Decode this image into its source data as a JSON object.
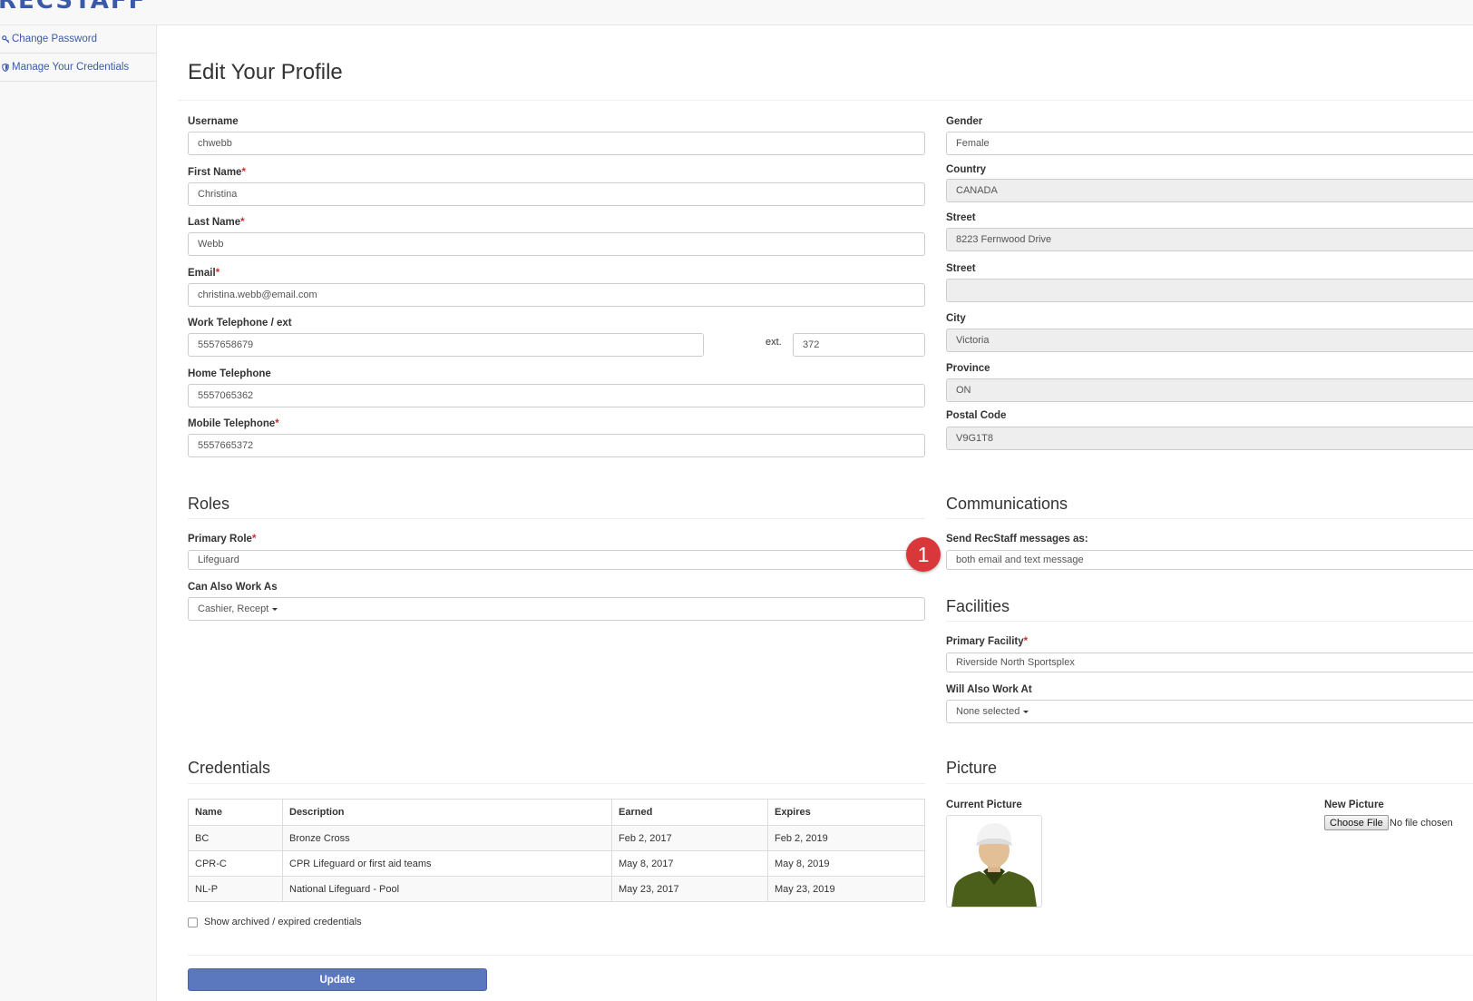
{
  "app": {
    "logo": "RECSTAFF"
  },
  "sidebar": {
    "items": [
      {
        "label": "Change Password",
        "icon": "key-icon"
      },
      {
        "label": "Manage Your Credentials",
        "icon": "shield-icon"
      }
    ]
  },
  "page": {
    "title": "Edit Your Profile"
  },
  "profile": {
    "username_label": "Username",
    "username": "chwebb",
    "first_name_label": "First Name",
    "first_name": "Christina",
    "last_name_label": "Last Name",
    "last_name": "Webb",
    "email_label": "Email",
    "email": "christina.webb@email.com",
    "work_phone_label": "Work Telephone / ext",
    "work_phone": "5557658679",
    "ext_label": "ext.",
    "ext": "372",
    "home_phone_label": "Home Telephone",
    "home_phone": "5557065362",
    "mobile_phone_label": "Mobile Telephone",
    "mobile_phone": "5557665372",
    "required_mark": "*"
  },
  "address": {
    "gender_label": "Gender",
    "gender": "Female",
    "country_label": "Country",
    "country": "CANADA",
    "street_label": "Street",
    "street1": "8223 Fernwood Drive",
    "street2_label": "Street",
    "street2": "",
    "city_label": "City",
    "city": "Victoria",
    "province_label": "Province",
    "province": "ON",
    "postal_label": "Postal Code",
    "postal": "V9G1T8"
  },
  "roles": {
    "heading": "Roles",
    "primary_label": "Primary Role",
    "primary": "Lifeguard",
    "also_label": "Can Also Work As",
    "also": "Cashier, Recept"
  },
  "communications": {
    "heading": "Communications",
    "send_label": "Send RecStaff messages as:",
    "send_value": "both email and text message",
    "badge": "1",
    "badge_color": "#d9383a"
  },
  "facilities": {
    "heading": "Facilities",
    "primary_label": "Primary Facility",
    "primary": "Riverside North Sportsplex",
    "also_label": "Will Also Work At",
    "also": "None selected"
  },
  "credentials": {
    "heading": "Credentials",
    "columns": [
      "Name",
      "Description",
      "Earned",
      "Expires"
    ],
    "rows": [
      [
        "BC",
        "Bronze Cross",
        "Feb 2, 2017",
        "Feb 2, 2019"
      ],
      [
        "CPR-C",
        "CPR Lifeguard or first aid teams",
        "May 8, 2017",
        "May 8, 2019"
      ],
      [
        "NL-P",
        "National Lifeguard - Pool",
        "May 23, 2017",
        "May 23, 2019"
      ]
    ],
    "show_archived_label": "Show archived / expired credentials"
  },
  "picture": {
    "heading": "Picture",
    "current_label": "Current Picture",
    "new_label": "New Picture",
    "choose_file": "Choose File",
    "no_file": "No file chosen"
  },
  "actions": {
    "update": "Update",
    "accent": "#5b78bf"
  }
}
